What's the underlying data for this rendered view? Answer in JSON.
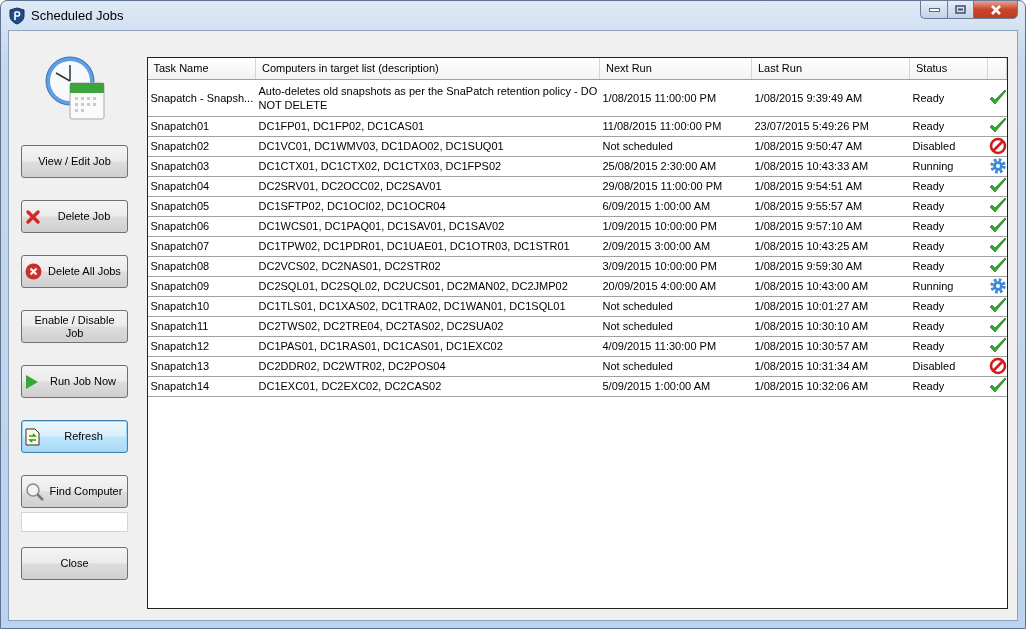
{
  "window": {
    "title": "Scheduled Jobs"
  },
  "buttons": [
    {
      "label": "View / Edit Job",
      "kind": "plain",
      "focused": false
    },
    {
      "label": "Delete Job",
      "kind": "delete",
      "focused": false
    },
    {
      "label": "Delete All Jobs",
      "kind": "delete-all",
      "focused": false
    },
    {
      "label": "Enable / Disable Job",
      "kind": "plain",
      "focused": false
    },
    {
      "label": "Run Job Now",
      "kind": "run",
      "focused": false
    },
    {
      "label": "Refresh",
      "kind": "refresh",
      "focused": true
    },
    {
      "label": "Find Computer",
      "kind": "find",
      "focused": false
    }
  ],
  "close_button": {
    "label": "Close"
  },
  "table": {
    "columns": [
      "Task Name",
      "Computers in target list (description)",
      "Next Run",
      "Last Run",
      "Status"
    ],
    "rows": [
      {
        "task_name": "Snapatch - Snapsh...",
        "computers": "Auto-deletes old snapshots as per the SnaPatch retention policy - DO NOT DELETE",
        "next_run": "1/08/2015 11:00:00 PM",
        "last_run": "1/08/2015 9:39:49 AM",
        "status": "Ready",
        "kind": "ready"
      },
      {
        "task_name": "Snapatch01",
        "computers": "DC1FP01, DC1FP02, DC1CAS01",
        "next_run": "11/08/2015 11:00:00 PM",
        "last_run": "23/07/2015 5:49:26 PM",
        "status": "Ready",
        "kind": "ready"
      },
      {
        "task_name": "Snapatch02",
        "computers": "DC1VC01, DC1WMV03, DC1DAO02, DC1SUQ01",
        "next_run": "Not scheduled",
        "last_run": "1/08/2015 9:50:47 AM",
        "status": "Disabled",
        "kind": "disabled"
      },
      {
        "task_name": "Snapatch03",
        "computers": "DC1CTX01, DC1CTX02, DC1CTX03, DC1FPS02",
        "next_run": "25/08/2015 2:30:00 AM",
        "last_run": "1/08/2015 10:43:33 AM",
        "status": "Running",
        "kind": "running"
      },
      {
        "task_name": "Snapatch04",
        "computers": "DC2SRV01, DC2OCC02, DC2SAV01",
        "next_run": "29/08/2015 11:00:00 PM",
        "last_run": "1/08/2015 9:54:51 AM",
        "status": "Ready",
        "kind": "ready"
      },
      {
        "task_name": "Snapatch05",
        "computers": "DC1SFTP02, DC1OCI02, DC1OCR04",
        "next_run": "6/09/2015 1:00:00 AM",
        "last_run": "1/08/2015 9:55:57 AM",
        "status": "Ready",
        "kind": "ready"
      },
      {
        "task_name": "Snapatch06",
        "computers": "DC1WCS01, DC1PAQ01, DC1SAV01, DC1SAV02",
        "next_run": "1/09/2015 10:00:00 PM",
        "last_run": "1/08/2015 9:57:10 AM",
        "status": "Ready",
        "kind": "ready"
      },
      {
        "task_name": "Snapatch07",
        "computers": "DC1TPW02, DC1PDR01, DC1UAE01, DC1OTR03, DC1STR01",
        "next_run": "2/09/2015 3:00:00 AM",
        "last_run": "1/08/2015 10:43:25 AM",
        "status": "Ready",
        "kind": "ready"
      },
      {
        "task_name": "Snapatch08",
        "computers": "DC2VCS02, DC2NAS01, DC2STR02",
        "next_run": "3/09/2015 10:00:00 PM",
        "last_run": "1/08/2015 9:59:30 AM",
        "status": "Ready",
        "kind": "ready"
      },
      {
        "task_name": "Snapatch09",
        "computers": "DC2SQL01, DC2SQL02, DC2UCS01, DC2MAN02, DC2JMP02",
        "next_run": "20/09/2015 4:00:00 AM",
        "last_run": "1/08/2015 10:43:00 AM",
        "status": "Running",
        "kind": "running"
      },
      {
        "task_name": "Snapatch10",
        "computers": "DC1TLS01, DC1XAS02, DC1TRA02, DC1WAN01, DC1SQL01",
        "next_run": "Not scheduled",
        "last_run": "1/08/2015 10:01:27 AM",
        "status": "Ready",
        "kind": "ready"
      },
      {
        "task_name": "Snapatch11",
        "computers": "DC2TWS02, DC2TRE04, DC2TAS02, DC2SUA02",
        "next_run": "Not scheduled",
        "last_run": "1/08/2015 10:30:10 AM",
        "status": "Ready",
        "kind": "ready"
      },
      {
        "task_name": "Snapatch12",
        "computers": "DC1PAS01, DC1RAS01, DC1CAS01, DC1EXC02",
        "next_run": "4/09/2015 11:30:00 PM",
        "last_run": "1/08/2015 10:30:57 AM",
        "status": "Ready",
        "kind": "ready"
      },
      {
        "task_name": "Snapatch13",
        "computers": "DC2DDR02, DC2WTR02, DC2POS04",
        "next_run": "Not scheduled",
        "last_run": "1/08/2015 10:31:34 AM",
        "status": "Disabled",
        "kind": "disabled"
      },
      {
        "task_name": "Snapatch14",
        "computers": "DC1EXC01, DC2EXC02, DC2CAS02",
        "next_run": "5/09/2015 1:00:00 AM",
        "last_run": "1/08/2015 10:32:06 AM",
        "status": "Ready",
        "kind": "ready"
      }
    ]
  }
}
